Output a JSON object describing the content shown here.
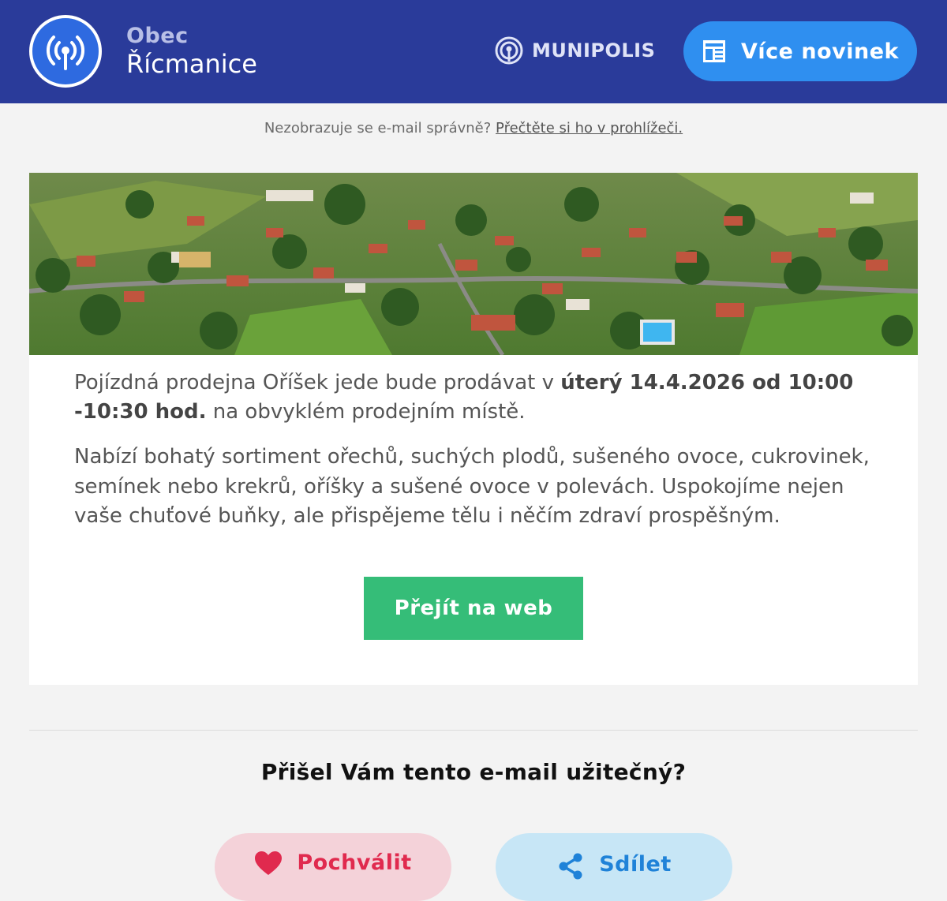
{
  "header": {
    "obec_label": "Obec",
    "town_name": "Řícmanice",
    "brand_name": "MUNIPOLIS",
    "more_news_label": "Více novinek",
    "logo_icon": "radio-broadcast-icon",
    "colors": {
      "header_bg": "#2a3b9a",
      "accent": "#2f8ff0"
    }
  },
  "browser_note": {
    "text": "Nezobrazuje se e-mail správně?",
    "link": "Přečtěte si ho v prohlížeči."
  },
  "article": {
    "hero_alt": "aerial-village-photo",
    "p1_before": "Pojízdná prodejna Oříšek jede bude prodávat v",
    "p1_bold": "úterý 14.4.2026 od 10:00 -10:30 hod.",
    "p1_after": "na obvyklém prodejním místě.",
    "p2": "Nabízí bohatý sortiment ořechů, suchých plodů, sušeného ovoce, cukrovinek, semínek nebo krekrů, oříšky a sušené ovoce v polevách.  Uspokojíme nejen vaše chuťové buňky, ale přispějeme tělu i něčím zdraví prospěšným.",
    "web_button_label": "Přejít na web",
    "colors": {
      "button": "#35bd78"
    }
  },
  "feedback": {
    "question": "Přišel Vám tento e-mail užitečný?",
    "praise_label": "Pochválit",
    "share_label": "Sdílet",
    "colors": {
      "praise": "#e02a4e",
      "share": "#1f82d8"
    }
  }
}
